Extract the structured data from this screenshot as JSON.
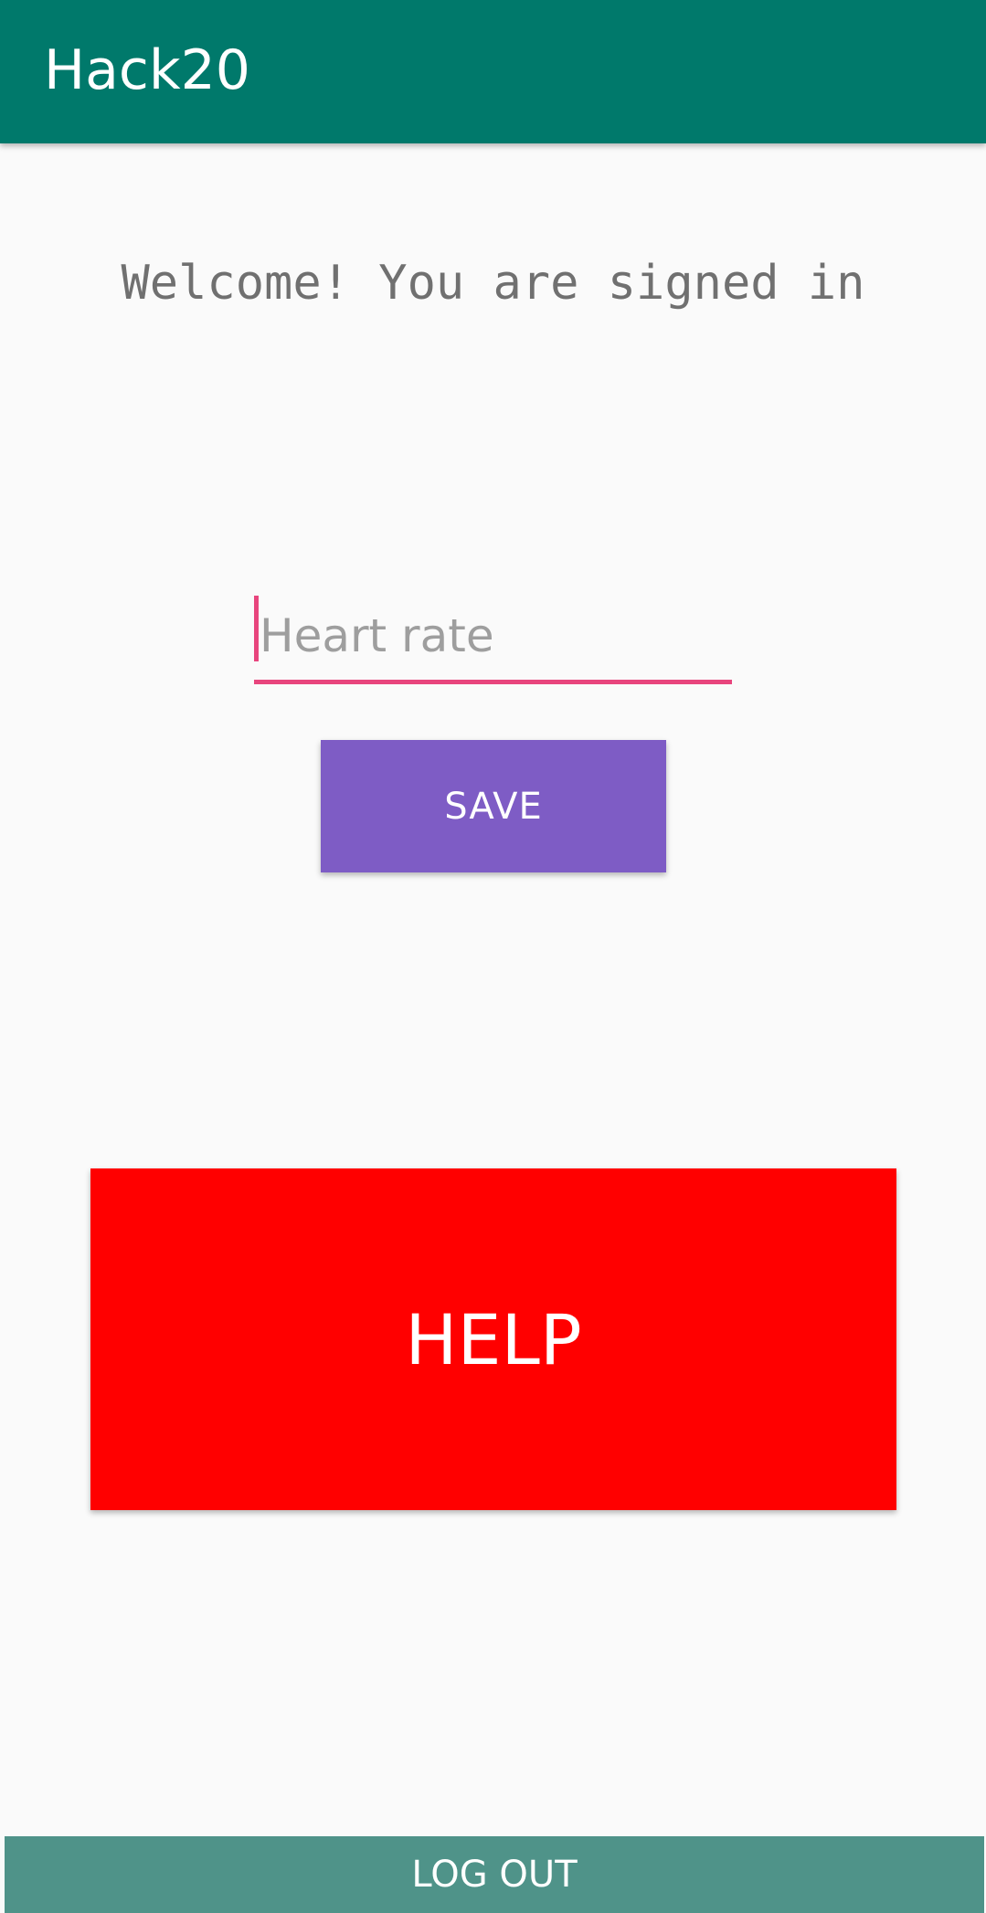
{
  "app_bar": {
    "title": "Hack20"
  },
  "welcome": {
    "message": "Welcome! You are signed in"
  },
  "heart_rate": {
    "value": "",
    "placeholder": "Heart rate"
  },
  "buttons": {
    "save_label": "SAVE",
    "help_label": "HELP",
    "logout_label": "LOG OUT"
  },
  "colors": {
    "app_bar": "#00796b",
    "accent": "#e8457d",
    "save_button": "#7e5cc5",
    "help_button": "#ff0000",
    "logout_button": "#4f9389",
    "background": "#fafafa"
  }
}
